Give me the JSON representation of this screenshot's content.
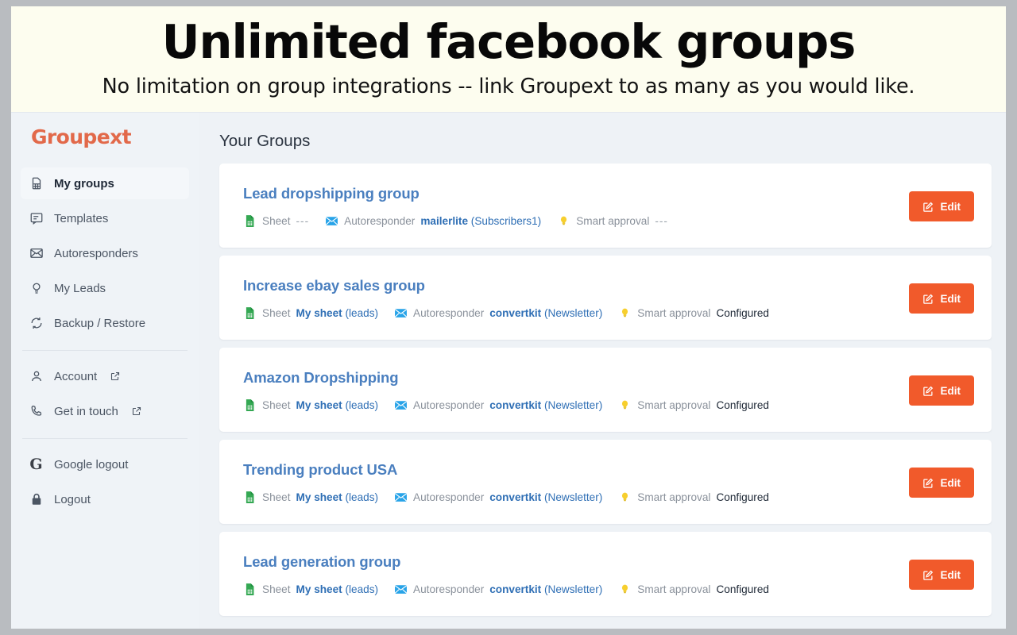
{
  "promo": {
    "title": "Unlimited facebook groups",
    "subtitle": "No limitation on group integrations -- link Groupext to as many as you would like."
  },
  "brand": {
    "logo": "Groupext",
    "logo_color": "#e2694a",
    "accent_color": "#f15a2b",
    "link_color": "#4a7fbf"
  },
  "sidebar": {
    "items": [
      {
        "label": "My groups",
        "icon": "sheet-page-icon",
        "active": true,
        "external": false
      },
      {
        "label": "Templates",
        "icon": "message-lines-icon",
        "active": false,
        "external": false
      },
      {
        "label": "Autoresponders",
        "icon": "envelope-icon",
        "active": false,
        "external": false
      },
      {
        "label": "My Leads",
        "icon": "lightbulb-icon",
        "active": false,
        "external": false
      },
      {
        "label": "Backup / Restore",
        "icon": "refresh-cycle-icon",
        "active": false,
        "external": false
      }
    ],
    "items2": [
      {
        "label": "Account",
        "icon": "user-icon",
        "external": true
      },
      {
        "label": "Get in touch",
        "icon": "phone-icon",
        "external": true
      }
    ],
    "items3": [
      {
        "label": "Google logout",
        "icon": "google-g-icon",
        "external": false
      },
      {
        "label": "Logout",
        "icon": "lock-icon",
        "external": false
      }
    ]
  },
  "main": {
    "title": "Your Groups",
    "labels": {
      "sheet": "Sheet",
      "autoresponder": "Autoresponder",
      "smart_approval": "Smart approval",
      "edit": "Edit"
    },
    "groups": [
      {
        "name": "Lead dropshipping group",
        "sheet_name": "",
        "sheet_tab": "",
        "sheet_empty": "---",
        "autoresponder_name": "mailerlite",
        "autoresponder_list": "(Subscribers1)",
        "smart_approval": "---"
      },
      {
        "name": "Increase ebay sales group",
        "sheet_name": "My sheet",
        "sheet_tab": "(leads)",
        "sheet_empty": "",
        "autoresponder_name": "convertkit",
        "autoresponder_list": "(Newsletter)",
        "smart_approval": "Configured"
      },
      {
        "name": "Amazon Dropshipping",
        "sheet_name": "My sheet",
        "sheet_tab": "(leads)",
        "sheet_empty": "",
        "autoresponder_name": "convertkit",
        "autoresponder_list": "(Newsletter)",
        "smart_approval": "Configured"
      },
      {
        "name": "Trending product USA",
        "sheet_name": "My sheet",
        "sheet_tab": "(leads)",
        "sheet_empty": "",
        "autoresponder_name": "convertkit",
        "autoresponder_list": "(Newsletter)",
        "smart_approval": "Configured"
      },
      {
        "name": "Lead generation group",
        "sheet_name": "My sheet",
        "sheet_tab": "(leads)",
        "sheet_empty": "",
        "autoresponder_name": "convertkit",
        "autoresponder_list": "(Newsletter)",
        "smart_approval": "Configured"
      }
    ]
  }
}
